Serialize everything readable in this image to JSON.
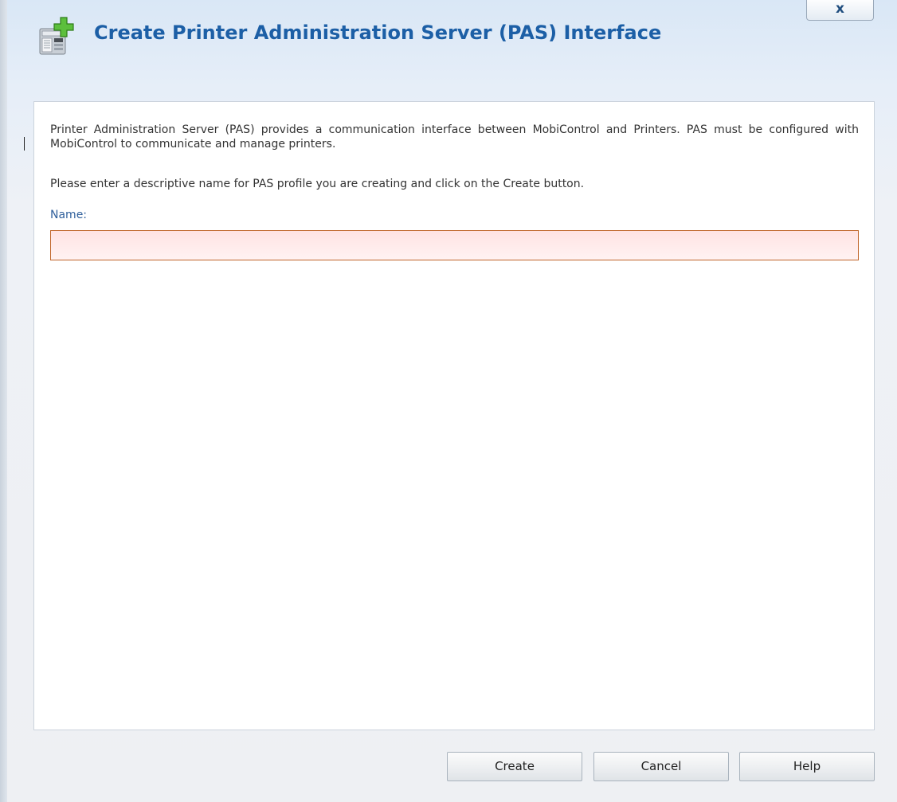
{
  "dialog": {
    "title": "Create Printer Administration Server (PAS) Interface",
    "title_icon": "add-printer-icon",
    "close_label": "x",
    "close_icon": "close-icon"
  },
  "content": {
    "description": "Printer Administration Server (PAS) provides a communication interface between MobiControl and Printers. PAS must be configured with MobiControl to communicate and manage printers.",
    "instruction": "Please enter a descriptive name for PAS profile you are creating and click on the Create button.",
    "name_label": "Name:",
    "name_value": ""
  },
  "buttons": {
    "create": "Create",
    "cancel": "Cancel",
    "help": "Help"
  },
  "colors": {
    "title": "#1c5fa6",
    "label": "#2f5f9b",
    "input_error_border": "#c0652a",
    "input_error_bg": "#ffe3e3"
  }
}
